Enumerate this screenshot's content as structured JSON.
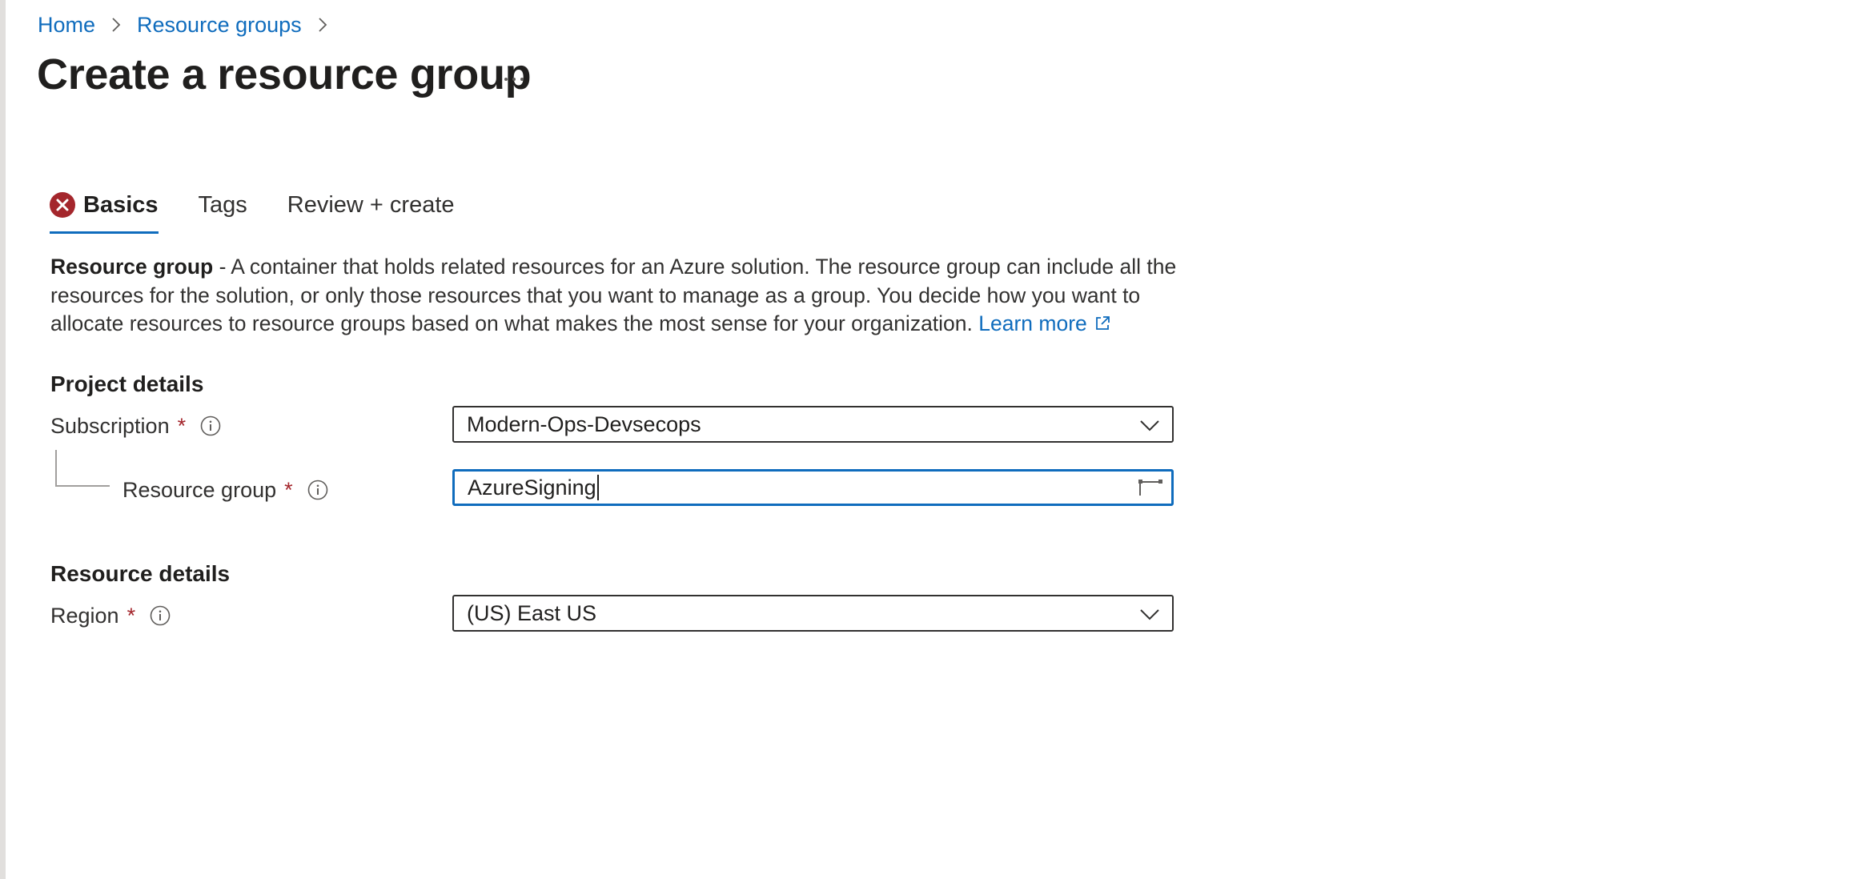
{
  "breadcrumb": {
    "items": [
      {
        "label": "Home"
      },
      {
        "label": "Resource groups"
      }
    ]
  },
  "page": {
    "title": "Create a resource group",
    "more_label": "..."
  },
  "tabs": [
    {
      "label": "Basics",
      "active": true,
      "error": true
    },
    {
      "label": "Tags"
    },
    {
      "label": "Review + create"
    }
  ],
  "description": {
    "bold": "Resource group",
    "text": " - A container that holds related resources for an Azure solution. The resource group can include all the resources for the solution, or only those resources that you want to manage as a group. You decide how you want to allocate resources to resource groups based on what makes the most sense for your organization. ",
    "learn_more": "Learn more"
  },
  "project_details": {
    "heading": "Project details",
    "subscription": {
      "label": "Subscription",
      "required": "*",
      "value": "Modern-Ops-Devsecops"
    },
    "resource_group": {
      "label": "Resource group",
      "required": "*",
      "value": "AzureSigning"
    }
  },
  "resource_details": {
    "heading": "Resource details",
    "region": {
      "label": "Region",
      "required": "*",
      "value": "(US) East US"
    }
  },
  "colors": {
    "link": "#0f6cbd",
    "error": "#a4262c",
    "focus": "#0f6cbd",
    "text": "#323130"
  },
  "icons": [
    "chevron-right-icon",
    "more-icon",
    "error-icon",
    "external-link-icon",
    "info-icon",
    "chevron-down-icon",
    "password-manager-icon"
  ]
}
